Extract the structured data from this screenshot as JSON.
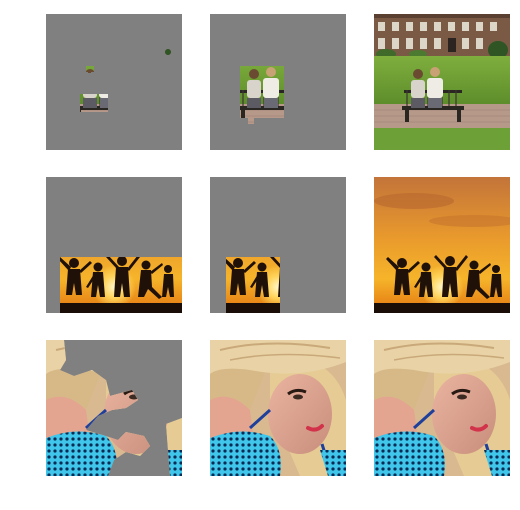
{
  "figure": {
    "rows": [
      {
        "subject": "couple-on-bench",
        "cells": [
          {
            "variant": "sparse-mask",
            "mask_color": "#808080"
          },
          {
            "variant": "partial-mask",
            "mask_color": "#808080"
          },
          {
            "variant": "original"
          }
        ]
      },
      {
        "subject": "sunset-silhouettes",
        "cells": [
          {
            "variant": "partial-mask",
            "mask_color": "#808080"
          },
          {
            "variant": "sparse-mask",
            "mask_color": "#808080"
          },
          {
            "variant": "original"
          }
        ]
      },
      {
        "subject": "woman-with-straw-hat",
        "cells": [
          {
            "variant": "sparse-mask",
            "mask_color": "#808080"
          },
          {
            "variant": "original"
          },
          {
            "variant": "original"
          }
        ]
      }
    ],
    "colors": {
      "mask_gray": "#808080",
      "background": "#ffffff"
    }
  }
}
